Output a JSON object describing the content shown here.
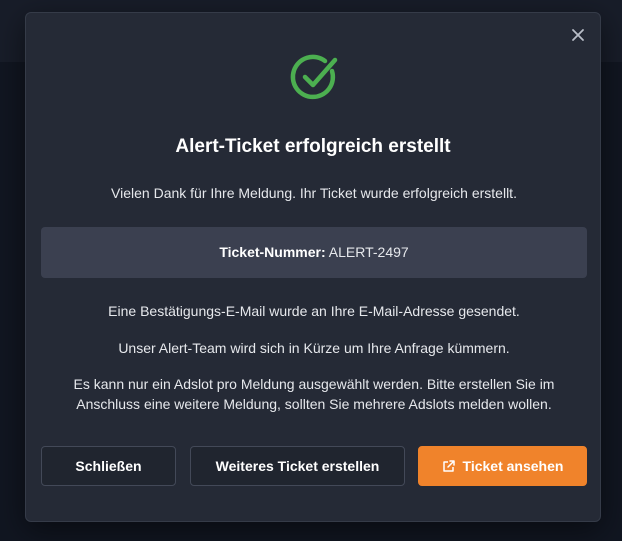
{
  "dialog": {
    "title": "Alert-Ticket erfolgreich erstellt",
    "intro": "Vielen Dank für Ihre Meldung. Ihr Ticket wurde erfolgreich erstellt.",
    "ticket_label": "Ticket-Nummer:",
    "ticket_number": "ALERT-2497",
    "confirmation_text": "Eine Bestätigungs-E-Mail wurde an Ihre E-Mail-Adresse gesendet.",
    "team_text": "Unser Alert-Team wird sich in Kürze um Ihre Anfrage kümmern.",
    "note_text": "Es kann nur ein Adslot pro Meldung ausgewählt werden. Bitte erstellen Sie im Anschluss eine weitere Meldung, sollten Sie mehrere Adslots melden wollen."
  },
  "buttons": {
    "close_label": "Schließen",
    "new_ticket_label": "Weiteres Ticket erstellen",
    "view_ticket_label": "Ticket ansehen"
  },
  "icons": {
    "success": "check-circle-icon",
    "close": "close-icon",
    "external": "external-link-icon"
  },
  "colors": {
    "accent": "#f0832b",
    "success": "#4caf50",
    "dialog_bg": "#252a36",
    "ticket_bg": "#3b4050"
  }
}
